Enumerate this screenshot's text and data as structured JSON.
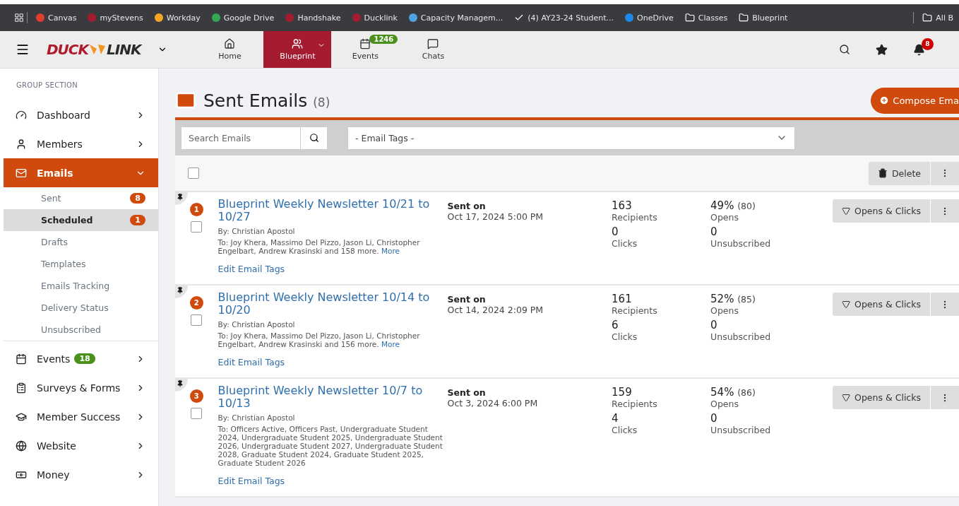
{
  "bookmarks": [
    {
      "label": "Canvas",
      "kind": "site",
      "color": "#e13c2c"
    },
    {
      "label": "myStevens",
      "kind": "site",
      "color": "#a51c30"
    },
    {
      "label": "Workday",
      "kind": "site",
      "color": "#f5a623"
    },
    {
      "label": "Google Drive",
      "kind": "site",
      "color": "#34a853"
    },
    {
      "label": "Handshake",
      "kind": "site",
      "color": "#a51c30"
    },
    {
      "label": "Ducklink",
      "kind": "site",
      "color": "#a51c30"
    },
    {
      "label": "Capacity Managem...",
      "kind": "site",
      "color": "#4fa3e0"
    },
    {
      "label": "(4) AY23-24 Student...",
      "kind": "check"
    },
    {
      "label": "OneDrive",
      "kind": "site",
      "color": "#1e88e5"
    },
    {
      "label": "Classes",
      "kind": "folder"
    },
    {
      "label": "Blueprint",
      "kind": "folder"
    }
  ],
  "all_bookmarks": "All B",
  "brand": {
    "left": "DUCK",
    "right": "LINK"
  },
  "nav_tabs": [
    {
      "label": "Home",
      "kind": "plain",
      "selected": false
    },
    {
      "label": "Blueprint",
      "kind": "dropdown",
      "selected": true
    },
    {
      "label": "Events",
      "kind": "plain",
      "selected": false,
      "badge": "1246"
    },
    {
      "label": "Chats",
      "kind": "plain",
      "selected": false
    }
  ],
  "notifications_badge": "8",
  "sidebar": {
    "heading": "GROUP SECTION",
    "items": [
      {
        "label": "Dashboard",
        "selected": false
      },
      {
        "label": "Members",
        "selected": false
      },
      {
        "label": "Emails",
        "selected": true,
        "expanded": true,
        "children": [
          {
            "label": "Sent",
            "selected": false,
            "badge": "8"
          },
          {
            "label": "Scheduled",
            "selected": true,
            "badge": "1"
          },
          {
            "label": "Drafts",
            "selected": false
          },
          {
            "label": "Templates",
            "selected": false
          },
          {
            "label": "Emails Tracking",
            "selected": false
          },
          {
            "label": "Delivery Status",
            "selected": false
          },
          {
            "label": "Unsubscribed",
            "selected": false
          }
        ]
      },
      {
        "label": "Events",
        "selected": false,
        "badge": "18"
      },
      {
        "label": "Surveys & Forms",
        "selected": false
      },
      {
        "label": "Member Success",
        "selected": false
      },
      {
        "label": "Website",
        "selected": false
      },
      {
        "label": "Money",
        "selected": false
      }
    ]
  },
  "page": {
    "title": "Sent Emails",
    "count": "(8)",
    "compose": "Compose Ema"
  },
  "filters": {
    "search_placeholder": "Search Emails",
    "tags_placeholder": "- Email Tags -"
  },
  "toolbar": {
    "select_all_checked": false,
    "delete": "Delete"
  },
  "emails": [
    {
      "number": "1",
      "checked": false,
      "title": "Blueprint Weekly Newsletter 10/21 to 10/27",
      "by": "By: Christian Apostol",
      "to": "To: Joy Khera, Massimo Del Pizzo, Jason Li, Christopher Engelbart, Andrew Krasinski and 158 more.",
      "more": "More",
      "edit_tags": "Edit Email Tags",
      "sent_label": "Sent on",
      "sent_date": "Oct 17, 2024 5:00 PM",
      "recipients": "163",
      "recipients_label": "Recipients",
      "clicks": "0",
      "clicks_label": "Clicks",
      "opens": "49%",
      "opens_count": "(80)",
      "opens_label": "Opens",
      "unsubscribed": "0",
      "unsubscribed_label": "Unsubscribed",
      "action": "Opens & Clicks"
    },
    {
      "number": "2",
      "checked": false,
      "title": "Blueprint Weekly Newsletter 10/14 to 10/20",
      "by": "By: Christian Apostol",
      "to": "To: Joy Khera, Massimo Del Pizzo, Jason Li, Christopher Engelbart, Andrew Krasinski and 156 more.",
      "more": "More",
      "edit_tags": "Edit Email Tags",
      "sent_label": "Sent on",
      "sent_date": "Oct 14, 2024 2:09 PM",
      "recipients": "161",
      "recipients_label": "Recipients",
      "clicks": "6",
      "clicks_label": "Clicks",
      "opens": "52%",
      "opens_count": "(85)",
      "opens_label": "Opens",
      "unsubscribed": "0",
      "unsubscribed_label": "Unsubscribed",
      "action": "Opens & Clicks"
    },
    {
      "number": "3",
      "checked": false,
      "title": "Blueprint Weekly Newsletter 10/7 to 10/13",
      "by": "By: Christian Apostol",
      "to": "To: Officers Active, Officers Past, Undergraduate Student 2024, Undergraduate Student 2025, Undergraduate Student 2026, Undergraduate Student 2027, Undergraduate Student 2028, Graduate Student 2024, Graduate Student 2025, Graduate Student 2026",
      "edit_tags": "Edit Email Tags",
      "sent_label": "Sent on",
      "sent_date": "Oct 3, 2024 6:00 PM",
      "recipients": "159",
      "recipients_label": "Recipients",
      "clicks": "4",
      "clicks_label": "Clicks",
      "opens": "54%",
      "opens_count": "(86)",
      "opens_label": "Opens",
      "unsubscribed": "0",
      "unsubscribed_label": "Unsubscribed",
      "action": "Opens & Clicks"
    }
  ]
}
